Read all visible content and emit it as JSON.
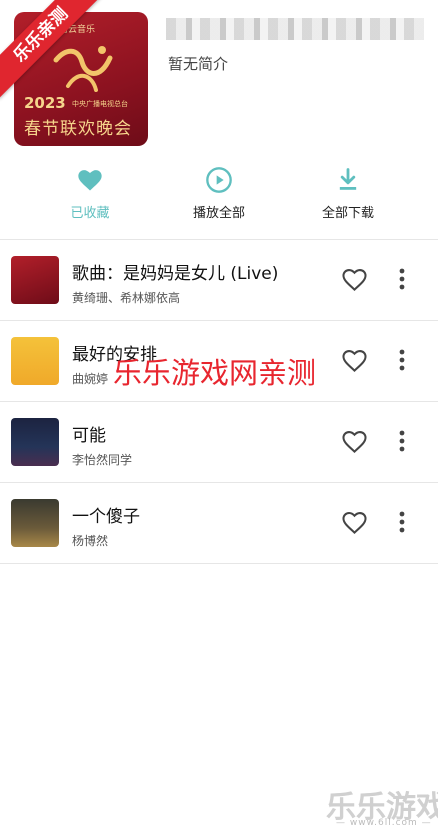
{
  "header": {
    "cover_brand": "网易云音乐",
    "cover_year": "2023",
    "cover_network": "中央广播电视总台",
    "cover_gala": "春节联欢晚会",
    "ribbon": "乐乐亲测",
    "intro": "暂无简介"
  },
  "actions": [
    {
      "label": "已收藏",
      "icon": "heart-filled-icon",
      "color": "#5fbfbf"
    },
    {
      "label": "播放全部",
      "icon": "play-circle-icon",
      "color": "#5fbfbf"
    },
    {
      "label": "全部下载",
      "icon": "download-icon",
      "color": "#5fbfbf"
    }
  ],
  "songs": [
    {
      "title": "歌曲：是妈妈是女儿 (Live)",
      "artist": "黄绮珊、希林娜依高"
    },
    {
      "title": "最好的安排",
      "artist": "曲婉婷"
    },
    {
      "title": "可能",
      "artist": "李怡然同学"
    },
    {
      "title": "一个傻子",
      "artist": "杨博然"
    }
  ],
  "watermark": {
    "center": "乐乐游戏网亲测",
    "corner": "乐乐游戏",
    "url": "— www.6ll.com —"
  },
  "colors": {
    "accent": "#5fbfbf",
    "watermark_red": "#e8262f"
  }
}
